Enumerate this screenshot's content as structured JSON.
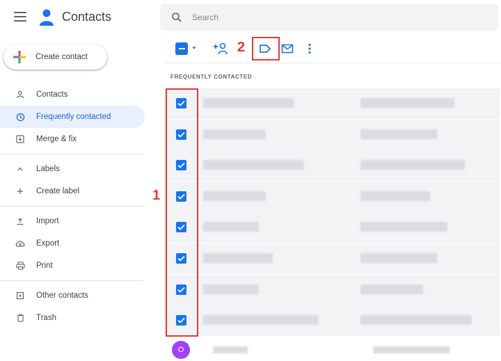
{
  "app": {
    "title": "Contacts"
  },
  "search": {
    "placeholder": "Search"
  },
  "create_button": {
    "label": "Create contact"
  },
  "sidebar": {
    "primary": [
      {
        "label": "Contacts",
        "icon": "person-icon",
        "active": false
      },
      {
        "label": "Frequently contacted",
        "icon": "history-icon",
        "active": true
      },
      {
        "label": "Merge & fix",
        "icon": "merge-icon",
        "active": false
      }
    ],
    "labels": [
      {
        "label": "Labels",
        "icon": "chevron-up-icon"
      },
      {
        "label": "Create label",
        "icon": "plus-icon"
      }
    ],
    "tools": [
      {
        "label": "Import",
        "icon": "upload-icon"
      },
      {
        "label": "Export",
        "icon": "cloud-download-icon"
      },
      {
        "label": "Print",
        "icon": "printer-icon"
      }
    ],
    "other": [
      {
        "label": "Other contacts",
        "icon": "archive-icon"
      },
      {
        "label": "Trash",
        "icon": "trash-icon"
      }
    ]
  },
  "toolbar": {
    "icons": [
      "select-all-checkbox-icon",
      "chevron-down-icon",
      "add-to-contacts-icon",
      "label-icon",
      "email-icon",
      "more-vert-icon"
    ]
  },
  "list": {
    "section_title": "FREQUENTLY CONTACTED",
    "selected_rows": 8,
    "avatar_letter": "O"
  },
  "annotations": {
    "first": "1",
    "second": "2"
  },
  "colors": {
    "accent": "#1a73e8",
    "active_bg": "#e8f0fe",
    "annotation": "#e53935",
    "avatar": "#a142f4"
  }
}
